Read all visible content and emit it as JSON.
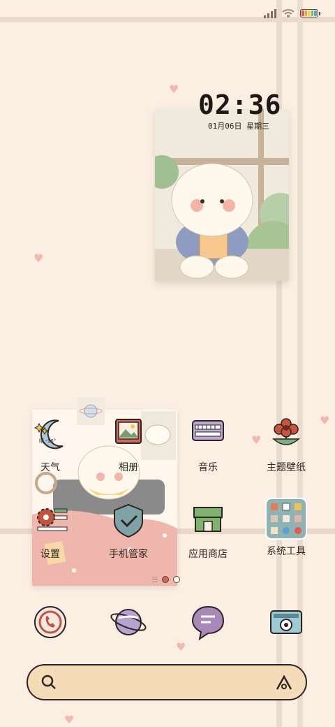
{
  "status_bar": {
    "battery_colors": [
      "#e25b4a",
      "#f2a33a",
      "#f5d34a",
      "#6cc06a",
      "#5aa2d6"
    ]
  },
  "clock": {
    "time": "02:36",
    "date": "01月06日  星期三"
  },
  "weather_badge": "晴 -16°",
  "apps_row1": [
    {
      "label": "天气",
      "icon": "weather-moon-icon"
    },
    {
      "label": "相册",
      "icon": "gallery-icon"
    },
    {
      "label": "音乐",
      "icon": "music-keyboard-icon"
    },
    {
      "label": "主题壁纸",
      "icon": "flower-theme-icon"
    }
  ],
  "apps_row2": [
    {
      "label": "设置",
      "icon": "settings-gear-icon"
    },
    {
      "label": "手机管家",
      "icon": "shield-check-icon"
    },
    {
      "label": "应用商店",
      "icon": "store-icon"
    },
    {
      "label": "系统工具",
      "icon": "folder-icon"
    }
  ],
  "dock": [
    {
      "name": "phone",
      "icon": "phone-icon"
    },
    {
      "name": "browser",
      "icon": "planet-icon"
    },
    {
      "name": "messages",
      "icon": "message-icon"
    },
    {
      "name": "camera",
      "icon": "camera-icon"
    }
  ],
  "search": {
    "placeholder": ""
  }
}
